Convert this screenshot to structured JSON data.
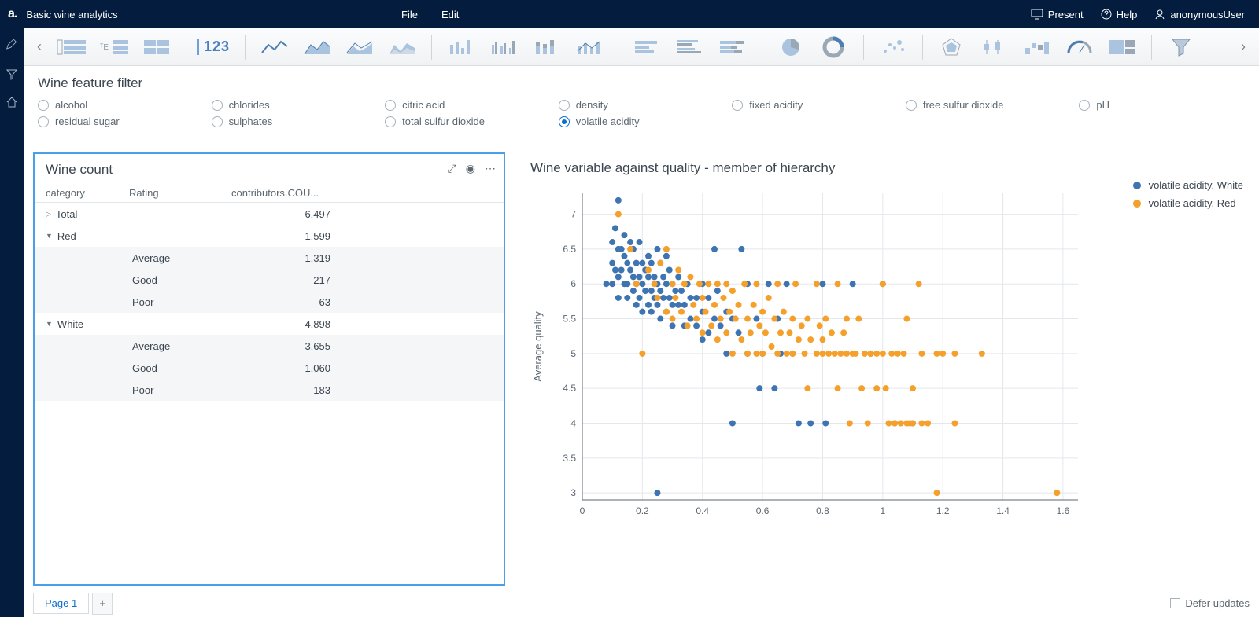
{
  "app": {
    "title": "Basic wine analytics"
  },
  "menu": {
    "file": "File",
    "edit": "Edit"
  },
  "topright": {
    "present": "Present",
    "help": "Help",
    "user": "anonymousUser"
  },
  "ribbon": {
    "kpi": "123"
  },
  "filter": {
    "title": "Wine feature filter",
    "items": [
      {
        "label": "alcohol",
        "selected": false
      },
      {
        "label": "chlorides",
        "selected": false
      },
      {
        "label": "citric acid",
        "selected": false
      },
      {
        "label": "density",
        "selected": false
      },
      {
        "label": "fixed acidity",
        "selected": false
      },
      {
        "label": "free sulfur dioxide",
        "selected": false
      },
      {
        "label": "pH",
        "selected": false
      },
      {
        "label": "residual sugar",
        "selected": false
      },
      {
        "label": "sulphates",
        "selected": false
      },
      {
        "label": "total sulfur dioxide",
        "selected": false
      },
      {
        "label": "volatile acidity",
        "selected": true
      }
    ]
  },
  "wineCount": {
    "title": "Wine count",
    "headers": {
      "c1": "category",
      "c2": "Rating",
      "c3": "contributors.COU..."
    },
    "rows": [
      {
        "level": 0,
        "expander": "▷",
        "cat": "Total",
        "rating": "",
        "val": "6,497"
      },
      {
        "level": 0,
        "expander": "▼",
        "cat": "Red",
        "rating": "",
        "val": "1,599"
      },
      {
        "level": 1,
        "rating": "Average",
        "val": "1,319"
      },
      {
        "level": 1,
        "rating": "Good",
        "val": "217"
      },
      {
        "level": 1,
        "rating": "Poor",
        "val": "63"
      },
      {
        "level": 0,
        "expander": "▼",
        "cat": "White",
        "rating": "",
        "val": "4,898"
      },
      {
        "level": 1,
        "rating": "Average",
        "val": "3,655"
      },
      {
        "level": 1,
        "rating": "Good",
        "val": "1,060"
      },
      {
        "level": 1,
        "rating": "Poor",
        "val": "183"
      }
    ]
  },
  "scatter": {
    "title": "Wine variable against quality - member of hierarchy",
    "ylabel": "Average quality",
    "legend": [
      {
        "label": "volatile acidity, White",
        "color": "#3e74b2"
      },
      {
        "label": "volatile acidity, Red",
        "color": "#f5a02a"
      }
    ],
    "xticks": [
      "0",
      "0.2",
      "0.4",
      "0.6",
      "0.8",
      "1",
      "1.2",
      "1.4",
      "1.6"
    ],
    "yticks": [
      "3",
      "3.5",
      "4",
      "4.5",
      "5",
      "5.5",
      "6",
      "6.5",
      "7"
    ]
  },
  "footer": {
    "page": "Page 1",
    "defer": "Defer updates"
  },
  "chart_data": {
    "type": "scatter",
    "title": "Wine variable against quality - member of hierarchy",
    "xlabel": "volatile acidity",
    "ylabel": "Average quality",
    "xlim": [
      0,
      1.65
    ],
    "ylim": [
      2.9,
      7.3
    ],
    "series": [
      {
        "name": "volatile acidity, White",
        "color": "#3e74b2",
        "points": [
          [
            0.08,
            6.0
          ],
          [
            0.1,
            6.6
          ],
          [
            0.1,
            6.3
          ],
          [
            0.1,
            6.0
          ],
          [
            0.11,
            6.8
          ],
          [
            0.11,
            6.2
          ],
          [
            0.12,
            7.2
          ],
          [
            0.12,
            6.5
          ],
          [
            0.12,
            6.1
          ],
          [
            0.12,
            5.8
          ],
          [
            0.13,
            6.5
          ],
          [
            0.13,
            6.2
          ],
          [
            0.14,
            6.7
          ],
          [
            0.14,
            6.4
          ],
          [
            0.14,
            6.0
          ],
          [
            0.15,
            6.3
          ],
          [
            0.15,
            6.0
          ],
          [
            0.15,
            5.8
          ],
          [
            0.16,
            6.6
          ],
          [
            0.16,
            6.2
          ],
          [
            0.17,
            6.5
          ],
          [
            0.17,
            6.1
          ],
          [
            0.17,
            5.9
          ],
          [
            0.18,
            6.0
          ],
          [
            0.18,
            6.3
          ],
          [
            0.18,
            5.7
          ],
          [
            0.19,
            6.6
          ],
          [
            0.19,
            6.1
          ],
          [
            0.19,
            5.8
          ],
          [
            0.2,
            6.3
          ],
          [
            0.2,
            6.0
          ],
          [
            0.2,
            5.6
          ],
          [
            0.21,
            6.2
          ],
          [
            0.21,
            5.9
          ],
          [
            0.22,
            6.4
          ],
          [
            0.22,
            6.1
          ],
          [
            0.22,
            5.7
          ],
          [
            0.23,
            6.3
          ],
          [
            0.23,
            5.9
          ],
          [
            0.23,
            5.6
          ],
          [
            0.24,
            6.1
          ],
          [
            0.24,
            5.8
          ],
          [
            0.25,
            6.5
          ],
          [
            0.25,
            6.0
          ],
          [
            0.25,
            5.7
          ],
          [
            0.25,
            3.0
          ],
          [
            0.26,
            6.3
          ],
          [
            0.26,
            5.9
          ],
          [
            0.26,
            5.5
          ],
          [
            0.27,
            6.1
          ],
          [
            0.27,
            5.8
          ],
          [
            0.28,
            6.4
          ],
          [
            0.28,
            6.0
          ],
          [
            0.28,
            5.6
          ],
          [
            0.29,
            6.2
          ],
          [
            0.29,
            5.8
          ],
          [
            0.3,
            6.0
          ],
          [
            0.3,
            5.7
          ],
          [
            0.3,
            5.4
          ],
          [
            0.31,
            5.9
          ],
          [
            0.32,
            6.1
          ],
          [
            0.32,
            5.7
          ],
          [
            0.33,
            5.9
          ],
          [
            0.34,
            5.7
          ],
          [
            0.34,
            5.4
          ],
          [
            0.35,
            6.0
          ],
          [
            0.36,
            5.8
          ],
          [
            0.36,
            5.5
          ],
          [
            0.38,
            5.8
          ],
          [
            0.38,
            5.4
          ],
          [
            0.4,
            6.0
          ],
          [
            0.4,
            5.6
          ],
          [
            0.4,
            5.2
          ],
          [
            0.42,
            5.8
          ],
          [
            0.42,
            5.3
          ],
          [
            0.44,
            5.5
          ],
          [
            0.44,
            6.5
          ],
          [
            0.45,
            5.9
          ],
          [
            0.46,
            5.4
          ],
          [
            0.48,
            5.6
          ],
          [
            0.48,
            5.0
          ],
          [
            0.5,
            5.5
          ],
          [
            0.5,
            4.0
          ],
          [
            0.52,
            5.3
          ],
          [
            0.53,
            6.5
          ],
          [
            0.55,
            6.0
          ],
          [
            0.55,
            5.0
          ],
          [
            0.58,
            5.5
          ],
          [
            0.59,
            4.5
          ],
          [
            0.6,
            5.0
          ],
          [
            0.62,
            6.0
          ],
          [
            0.64,
            4.5
          ],
          [
            0.65,
            5.5
          ],
          [
            0.66,
            5.0
          ],
          [
            0.68,
            6.0
          ],
          [
            0.7,
            5.0
          ],
          [
            0.72,
            4.0
          ],
          [
            0.76,
            4.0
          ],
          [
            0.8,
            6.0
          ],
          [
            0.81,
            4.0
          ],
          [
            0.9,
            6.0
          ],
          [
            0.96,
            5.0
          ],
          [
            1.0,
            6.0
          ],
          [
            1.04,
            4.0
          ],
          [
            1.1,
            4.0
          ]
        ]
      },
      {
        "name": "volatile acidity, Red",
        "color": "#f5a02a",
        "points": [
          [
            0.12,
            7.0
          ],
          [
            0.16,
            6.5
          ],
          [
            0.18,
            6.0
          ],
          [
            0.2,
            5.0
          ],
          [
            0.22,
            6.2
          ],
          [
            0.24,
            6.0
          ],
          [
            0.25,
            5.8
          ],
          [
            0.26,
            6.3
          ],
          [
            0.28,
            5.6
          ],
          [
            0.28,
            6.5
          ],
          [
            0.3,
            6.0
          ],
          [
            0.3,
            5.5
          ],
          [
            0.31,
            5.8
          ],
          [
            0.32,
            6.2
          ],
          [
            0.33,
            5.6
          ],
          [
            0.34,
            6.0
          ],
          [
            0.35,
            5.4
          ],
          [
            0.36,
            6.1
          ],
          [
            0.37,
            5.7
          ],
          [
            0.38,
            5.5
          ],
          [
            0.39,
            6.0
          ],
          [
            0.4,
            5.8
          ],
          [
            0.4,
            5.3
          ],
          [
            0.41,
            5.6
          ],
          [
            0.42,
            6.0
          ],
          [
            0.43,
            5.4
          ],
          [
            0.44,
            5.7
          ],
          [
            0.45,
            6.0
          ],
          [
            0.45,
            5.2
          ],
          [
            0.46,
            5.5
          ],
          [
            0.47,
            5.8
          ],
          [
            0.48,
            6.0
          ],
          [
            0.48,
            5.3
          ],
          [
            0.49,
            5.6
          ],
          [
            0.5,
            5.9
          ],
          [
            0.5,
            5.0
          ],
          [
            0.51,
            5.5
          ],
          [
            0.52,
            5.7
          ],
          [
            0.53,
            5.2
          ],
          [
            0.54,
            6.0
          ],
          [
            0.55,
            5.5
          ],
          [
            0.55,
            5.0
          ],
          [
            0.56,
            5.3
          ],
          [
            0.57,
            5.7
          ],
          [
            0.58,
            6.0
          ],
          [
            0.58,
            5.0
          ],
          [
            0.59,
            5.4
          ],
          [
            0.6,
            5.6
          ],
          [
            0.6,
            5.0
          ],
          [
            0.61,
            5.3
          ],
          [
            0.62,
            5.8
          ],
          [
            0.63,
            5.1
          ],
          [
            0.64,
            5.5
          ],
          [
            0.65,
            6.0
          ],
          [
            0.65,
            5.0
          ],
          [
            0.66,
            5.3
          ],
          [
            0.67,
            5.6
          ],
          [
            0.68,
            5.0
          ],
          [
            0.69,
            5.3
          ],
          [
            0.7,
            5.5
          ],
          [
            0.7,
            5.0
          ],
          [
            0.71,
            6.0
          ],
          [
            0.72,
            5.2
          ],
          [
            0.73,
            5.4
          ],
          [
            0.74,
            5.0
          ],
          [
            0.75,
            5.5
          ],
          [
            0.75,
            4.5
          ],
          [
            0.76,
            5.2
          ],
          [
            0.78,
            6.0
          ],
          [
            0.78,
            5.0
          ],
          [
            0.79,
            5.4
          ],
          [
            0.8,
            5.2
          ],
          [
            0.8,
            5.0
          ],
          [
            0.81,
            5.5
          ],
          [
            0.82,
            5.0
          ],
          [
            0.83,
            5.3
          ],
          [
            0.84,
            5.0
          ],
          [
            0.85,
            6.0
          ],
          [
            0.85,
            4.5
          ],
          [
            0.86,
            5.0
          ],
          [
            0.87,
            5.3
          ],
          [
            0.88,
            5.5
          ],
          [
            0.88,
            5.0
          ],
          [
            0.89,
            4.0
          ],
          [
            0.9,
            5.0
          ],
          [
            0.91,
            5.0
          ],
          [
            0.92,
            5.5
          ],
          [
            0.93,
            4.5
          ],
          [
            0.94,
            5.0
          ],
          [
            0.95,
            4.0
          ],
          [
            0.96,
            5.0
          ],
          [
            0.98,
            5.0
          ],
          [
            0.98,
            4.5
          ],
          [
            1.0,
            5.0
          ],
          [
            1.0,
            6.0
          ],
          [
            1.01,
            4.5
          ],
          [
            1.02,
            4.0
          ],
          [
            1.03,
            5.0
          ],
          [
            1.04,
            4.0
          ],
          [
            1.05,
            5.0
          ],
          [
            1.06,
            4.0
          ],
          [
            1.07,
            5.0
          ],
          [
            1.08,
            5.5
          ],
          [
            1.08,
            4.0
          ],
          [
            1.09,
            4.0
          ],
          [
            1.1,
            4.5
          ],
          [
            1.1,
            4.0
          ],
          [
            1.12,
            6.0
          ],
          [
            1.13,
            5.0
          ],
          [
            1.13,
            4.0
          ],
          [
            1.15,
            4.0
          ],
          [
            1.18,
            5.0
          ],
          [
            1.18,
            3.0
          ],
          [
            1.2,
            5.0
          ],
          [
            1.24,
            5.0
          ],
          [
            1.24,
            4.0
          ],
          [
            1.33,
            5.0
          ],
          [
            1.58,
            3.0
          ]
        ]
      }
    ]
  }
}
